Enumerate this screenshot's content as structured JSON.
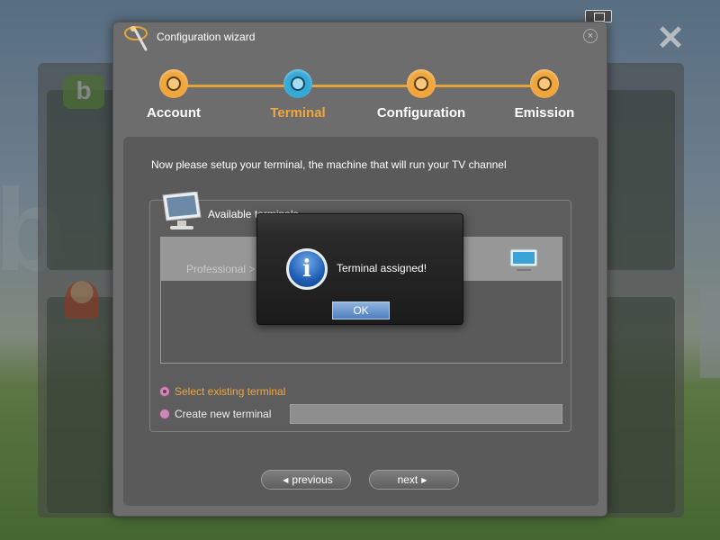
{
  "desktop": {
    "logo_text": "b",
    "big_letter": "b"
  },
  "wizard": {
    "title": "Configuration wizard",
    "close_symbol": "×"
  },
  "steps": [
    {
      "label": "Account",
      "active": false
    },
    {
      "label": "Terminal",
      "active": true
    },
    {
      "label": "Configuration",
      "active": false
    },
    {
      "label": "Emission",
      "active": false
    }
  ],
  "content": {
    "instruction": "Now please setup your terminal, the machine that will run your TV channel",
    "terminals_title": "Available terminals",
    "terminal_row_label": "Professional >",
    "radio_existing": "Select existing terminal",
    "radio_new": "Create new terminal",
    "new_terminal_value": ""
  },
  "nav": {
    "previous": "previous",
    "next": "next"
  },
  "modal": {
    "message": "Terminal assigned!",
    "ok": "OK",
    "icon_glyph": "i"
  },
  "colors": {
    "accent_orange": "#f0a63c",
    "active_step_blue": "#37a9d6",
    "radio_pink": "#c98ab3"
  }
}
